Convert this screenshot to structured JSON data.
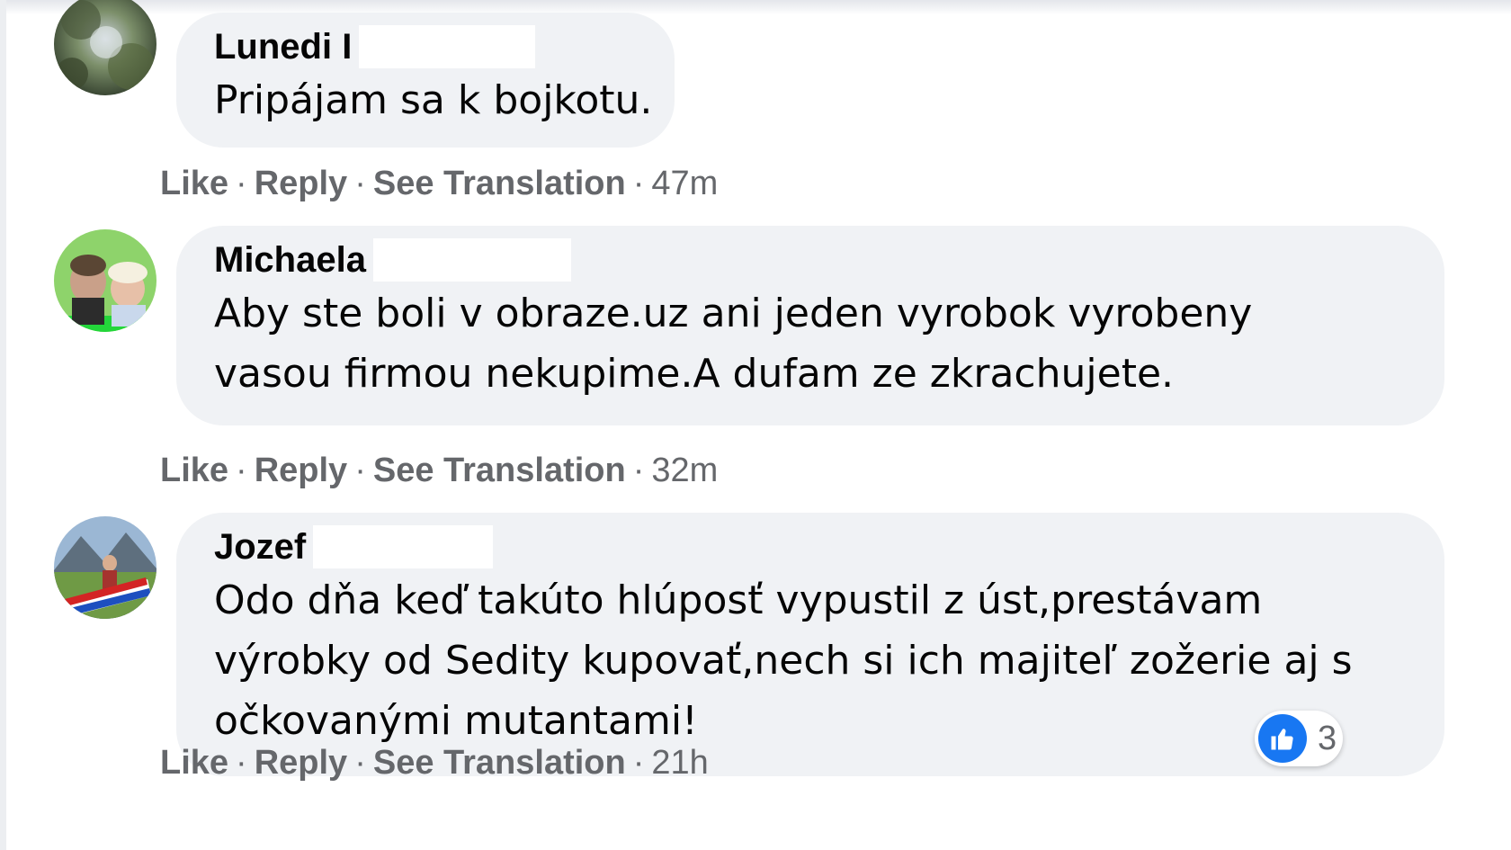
{
  "comments": [
    {
      "author": "Lunedi I",
      "text_lines": [
        "Pripájam sa k bojkotu."
      ],
      "actions": {
        "like": "Like",
        "reply": "Reply",
        "translate": "See Translation",
        "time": "47m"
      }
    },
    {
      "author": "Michaela",
      "text_lines": [
        "Aby ste boli v obraze.uz ani jeden vyrobok vyrobeny",
        "vasou firmou nekupime.A dufam ze zkrachujete."
      ],
      "actions": {
        "like": "Like",
        "reply": "Reply",
        "translate": "See Translation",
        "time": "32m"
      }
    },
    {
      "author": "Jozef",
      "text_lines": [
        "Odo dňa keď takúto hlúposť vypustil z úst,prestávam",
        "výrobky od Sedity kupovať,nech si ich majiteľ zožerie aj s",
        "očkovanými mutantami!"
      ],
      "actions": {
        "like": "Like",
        "reply": "Reply",
        "translate": "See Translation",
        "time": "21h"
      },
      "reactions": {
        "icon": "like-reaction-icon",
        "count": "3"
      }
    }
  ],
  "separator": "·",
  "colors": {
    "bubble": "#f0f2f5",
    "action_text": "#65676b",
    "like_blue": "#1877f2"
  }
}
